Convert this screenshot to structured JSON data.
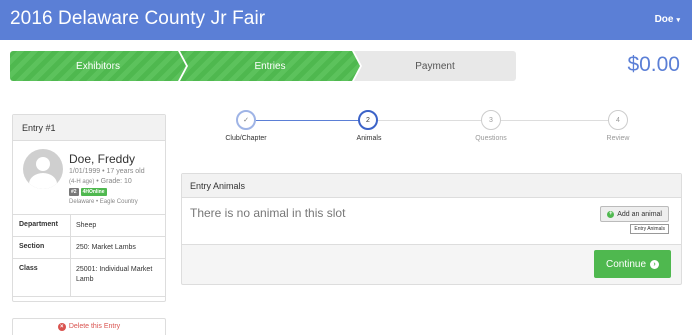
{
  "header": {
    "title": "2016 Delaware County Jr Fair",
    "user_label": "Doe",
    "user_caret": "▾"
  },
  "progress": {
    "steps": [
      {
        "label": "Exhibitors",
        "state": "done"
      },
      {
        "label": "Entries",
        "state": "done"
      },
      {
        "label": "Payment",
        "state": "todo"
      }
    ],
    "total": "$0.00"
  },
  "entry_card": {
    "title": "Entry #1",
    "name": "Doe, Freddy",
    "dob": "1/01/1999 • 17 years old",
    "grade_prefix": "(4-H age)",
    "grade": " • Grade: 10",
    "badges": [
      "#2",
      "4HOnline"
    ],
    "location": "Delaware • Eagle Country",
    "fields": [
      {
        "key": "Department",
        "value": "Sheep"
      },
      {
        "key": "Section",
        "value": "250: Market Lambs"
      },
      {
        "key": "Class",
        "value": "25001: Individual Market Lamb"
      }
    ],
    "delete_label": "Delete this Entry"
  },
  "wizard": {
    "steps": [
      {
        "num": "✓",
        "label": "Club/Chapter",
        "state": "done"
      },
      {
        "num": "2",
        "label": "Animals",
        "state": "active"
      },
      {
        "num": "3",
        "label": "Questions",
        "state": "todo"
      },
      {
        "num": "4",
        "label": "Review",
        "state": "todo"
      }
    ]
  },
  "animals_panel": {
    "title": "Entry Animals",
    "empty_text": "There is no animal in this slot",
    "add_label": "Add an animal",
    "tooltip": "Entry Animals",
    "continue_label": "Continue"
  },
  "icons": {
    "check": "check-icon",
    "plus": "plus-circle-icon",
    "arrow": "arrow-right-circle-icon",
    "delete": "remove-circle-icon",
    "avatar": "user-avatar-icon"
  },
  "colors": {
    "header_blue": "#5b7fd6",
    "success_green": "#4fb84f",
    "danger_red": "#d9534f"
  }
}
